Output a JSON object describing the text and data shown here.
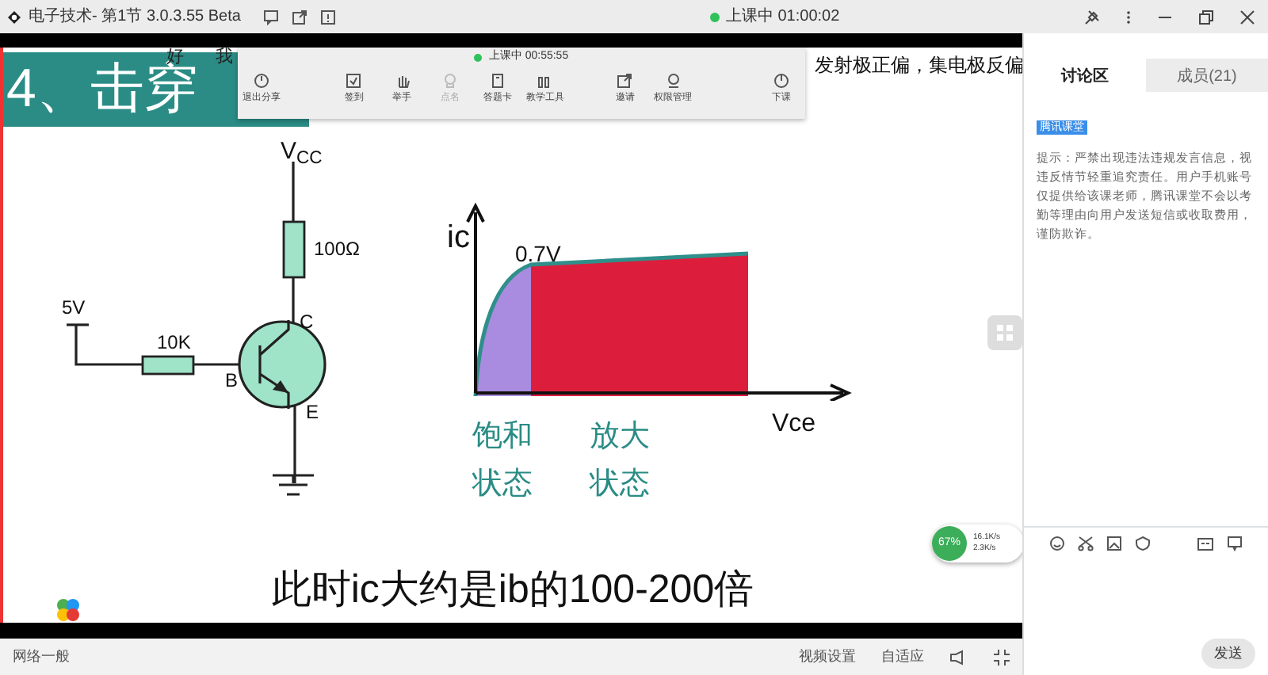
{
  "title_bar": {
    "app_title": "电子技术- 第1节 3.0.3.55 Beta",
    "status": "上课中 01:00:02"
  },
  "slide": {
    "title": "4、击穿",
    "danmaku": [
      "好",
      "我"
    ],
    "subtitle": "发射极正偏，集电极反偏",
    "circuit_labels": [
      "V$_{CC}$",
      "100Ω",
      "C",
      "5V",
      "10K",
      "B",
      "E"
    ],
    "graph_labels": [
      "ic",
      "0.7V",
      "Vce"
    ],
    "regions": [
      {
        "label": "饱和",
        "label_2": "状态",
        "color": "#a98be0"
      },
      {
        "label": "放大",
        "label_2": "状态",
        "color": "#dc1e3c"
      }
    ],
    "caption": "此时ic大约是ib的100-200倍"
  },
  "floating_toolbar": {
    "status": "上课中 00:55:55",
    "items": [
      {
        "label": "退出分享",
        "disabled": false
      },
      {
        "label": "签到",
        "disabled": false
      },
      {
        "label": "举手",
        "disabled": false
      },
      {
        "label": "点名",
        "disabled": true
      },
      {
        "label": "答题卡",
        "disabled": false
      },
      {
        "label": "教学工具",
        "disabled": false
      },
      {
        "label": "邀请",
        "disabled": false
      },
      {
        "label": "权限管理",
        "disabled": false
      },
      {
        "label": "下课",
        "disabled": false
      }
    ]
  },
  "network_widget": {
    "usage": "67%",
    "upload": "16.1K/s",
    "download": "2.3K/s"
  },
  "side_panel": {
    "tabs": [
      {
        "label": "讨论区",
        "selected": true
      },
      {
        "label": "成员(21)",
        "selected": false
      }
    ],
    "badge": "腾讯课堂",
    "notice": "提示：严禁出现违法违规发言信息，视违反情节轻重追究责任。用户手机账号仅提供给该课老师，腾讯课堂不会以考勤等理由向用户发送短信或收取费用，谨防欺诈。",
    "send_button": "发送"
  },
  "status_bar": {
    "network": "网络一般",
    "items": [
      "视频设置",
      "自适应"
    ]
  }
}
